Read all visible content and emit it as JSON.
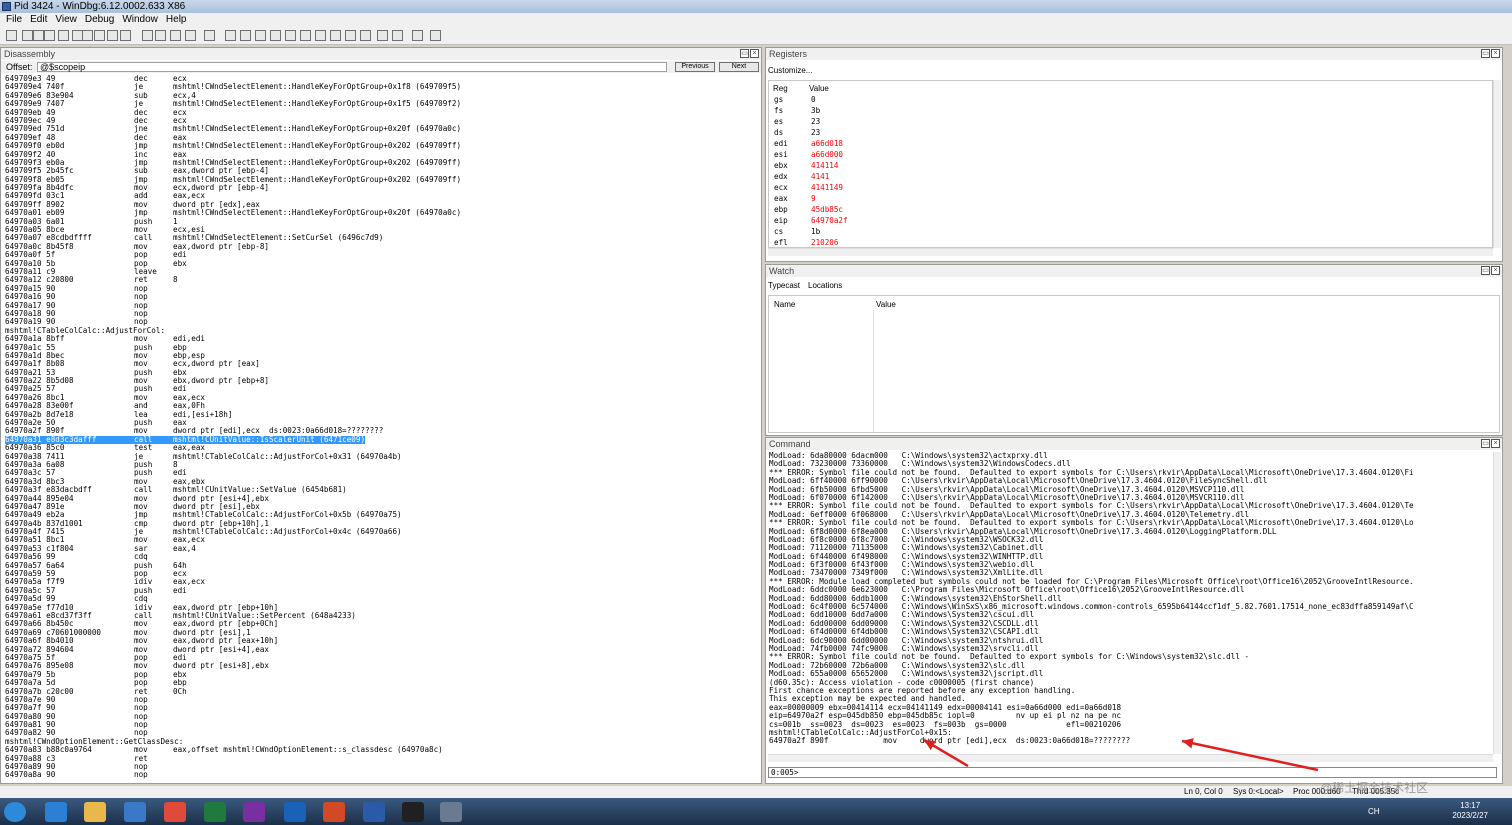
{
  "window": {
    "title": "Pid 3424 - WinDbg:6.12.0002.633 X86"
  },
  "menu": [
    "File",
    "Edit",
    "View",
    "Debug",
    "Window",
    "Help"
  ],
  "disassembly": {
    "title": "Disassembly",
    "offset_label": "Offset:",
    "offset_value": "@$scopeip",
    "prev_label": "Previous",
    "next_label": "Next",
    "highlight_index": 43,
    "lines": [
      [
        "649709e3 49",
        "dec",
        "ecx"
      ],
      [
        "649709e4 740f",
        "je",
        "mshtml!CWndSelectElement::HandleKeyForOptGroup+0x1f8 (649709f5)"
      ],
      [
        "649709e6 83e904",
        "sub",
        "ecx,4"
      ],
      [
        "649709e9 7407",
        "je",
        "mshtml!CWndSelectElement::HandleKeyForOptGroup+0x1f5 (649709f2)"
      ],
      [
        "649709eb 49",
        "dec",
        "ecx"
      ],
      [
        "649709ec 49",
        "dec",
        "ecx"
      ],
      [
        "649709ed 751d",
        "jne",
        "mshtml!CWndSelectElement::HandleKeyForOptGroup+0x20f (64970a0c)"
      ],
      [
        "649709ef 48",
        "dec",
        "eax"
      ],
      [
        "649709f0 eb0d",
        "jmp",
        "mshtml!CWndSelectElement::HandleKeyForOptGroup+0x202 (649709ff)"
      ],
      [
        "649709f2 40",
        "inc",
        "eax"
      ],
      [
        "649709f3 eb0a",
        "jmp",
        "mshtml!CWndSelectElement::HandleKeyForOptGroup+0x202 (649709ff)"
      ],
      [
        "649709f5 2b45fc",
        "sub",
        "eax,dword ptr [ebp-4]"
      ],
      [
        "649709f8 eb05",
        "jmp",
        "mshtml!CWndSelectElement::HandleKeyForOptGroup+0x202 (649709ff)"
      ],
      [
        "649709fa 8b4dfc",
        "mov",
        "ecx,dword ptr [ebp-4]"
      ],
      [
        "649709fd 03c1",
        "add",
        "eax,ecx"
      ],
      [
        "649709ff 8902",
        "mov",
        "dword ptr [edx],eax"
      ],
      [
        "64970a01 eb09",
        "jmp",
        "mshtml!CWndSelectElement::HandleKeyForOptGroup+0x20f (64970a0c)"
      ],
      [
        "64970a03 6a01",
        "push",
        "1"
      ],
      [
        "64970a05 8bce",
        "mov",
        "ecx,esi"
      ],
      [
        "64970a07 e8cdbdffff",
        "call",
        "mshtml!CWndSelectElement::SetCurSel (6496c7d9)"
      ],
      [
        "64970a0c 8b45f8",
        "mov",
        "eax,dword ptr [ebp-8]"
      ],
      [
        "64970a0f 5f",
        "pop",
        "edi"
      ],
      [
        "64970a10 5b",
        "pop",
        "ebx"
      ],
      [
        "64970a11 c9",
        "leave",
        ""
      ],
      [
        "64970a12 c20800",
        "ret",
        "8"
      ],
      [
        "64970a15 90",
        "nop",
        ""
      ],
      [
        "64970a16 90",
        "nop",
        ""
      ],
      [
        "64970a17 90",
        "nop",
        ""
      ],
      [
        "64970a18 90",
        "nop",
        ""
      ],
      [
        "64970a19 90",
        "nop",
        ""
      ],
      [
        "mshtml!CTableColCalc::AdjustForCol:",
        "",
        ""
      ],
      [
        "64970a1a 8bff",
        "mov",
        "edi,edi"
      ],
      [
        "64970a1c 55",
        "push",
        "ebp"
      ],
      [
        "64970a1d 8bec",
        "mov",
        "ebp,esp"
      ],
      [
        "64970a1f 8b08",
        "mov",
        "ecx,dword ptr [eax]"
      ],
      [
        "64970a21 53",
        "push",
        "ebx"
      ],
      [
        "64970a22 8b5d08",
        "mov",
        "ebx,dword ptr [ebp+8]"
      ],
      [
        "64970a25 57",
        "push",
        "edi"
      ],
      [
        "64970a26 8bc1",
        "mov",
        "eax,ecx"
      ],
      [
        "64970a28 83e00f",
        "and",
        "eax,0Fh"
      ],
      [
        "64970a2b 8d7e18",
        "lea",
        "edi,[esi+18h]"
      ],
      [
        "64970a2e 50",
        "push",
        "eax"
      ],
      [
        "64970a2f 890f",
        "mov",
        "dword ptr [edi],ecx  ds:0023:0a66d018=????????"
      ],
      [
        "64970a31 e8d3c3dafff",
        "call",
        "mshtml!CUnitValue::IsScalerUnit (6471ce09)"
      ],
      [
        "64970a36 85c0",
        "test",
        "eax,eax"
      ],
      [
        "64970a38 7411",
        "je",
        "mshtml!CTableColCalc::AdjustForCol+0x31 (64970a4b)"
      ],
      [
        "64970a3a 6a08",
        "push",
        "8"
      ],
      [
        "64970a3c 57",
        "push",
        "edi"
      ],
      [
        "64970a3d 8bc3",
        "mov",
        "eax,ebx"
      ],
      [
        "64970a3f e83dacbdff",
        "call",
        "mshtml!CUnitValue::SetValue (6454b681)"
      ],
      [
        "64970a44 895e04",
        "mov",
        "dword ptr [esi+4],ebx"
      ],
      [
        "64970a47 891e",
        "mov",
        "dword ptr [esi],ebx"
      ],
      [
        "64970a49 eb2a",
        "jmp",
        "mshtml!CTableColCalc::AdjustForCol+0x5b (64970a75)"
      ],
      [
        "64970a4b 837d1001",
        "cmp",
        "dword ptr [ebp+10h],1"
      ],
      [
        "64970a4f 7415",
        "je",
        "mshtml!CTableColCalc::AdjustForCol+0x4c (64970a66)"
      ],
      [
        "64970a51 8bc1",
        "mov",
        "eax,ecx"
      ],
      [
        "64970a53 c1f804",
        "sar",
        "eax,4"
      ],
      [
        "64970a56 99",
        "cdq",
        ""
      ],
      [
        "64970a57 6a64",
        "push",
        "64h"
      ],
      [
        "64970a59 59",
        "pop",
        "ecx"
      ],
      [
        "64970a5a f7f9",
        "idiv",
        "eax,ecx"
      ],
      [
        "64970a5c 57",
        "push",
        "edi"
      ],
      [
        "64970a5d 99",
        "cdq",
        ""
      ],
      [
        "64970a5e f77d10",
        "idiv",
        "eax,dword ptr [ebp+10h]"
      ],
      [
        "64970a61 e8cd37f3ff",
        "call",
        "mshtml!CUnitValue::SetPercent (648a4233)"
      ],
      [
        "64970a66 8b450c",
        "mov",
        "eax,dword ptr [ebp+0Ch]"
      ],
      [
        "64970a69 c70601000000",
        "mov",
        "dword ptr [esi],1"
      ],
      [
        "64970a6f 8b4010",
        "mov",
        "eax,dword ptr [eax+10h]"
      ],
      [
        "64970a72 894604",
        "mov",
        "dword ptr [esi+4],eax"
      ],
      [
        "64970a75 5f",
        "pop",
        "edi"
      ],
      [
        "64970a76 895e08",
        "mov",
        "dword ptr [esi+8],ebx"
      ],
      [
        "64970a79 5b",
        "pop",
        "ebx"
      ],
      [
        "64970a7a 5d",
        "pop",
        "ebp"
      ],
      [
        "64970a7b c20c00",
        "ret",
        "0Ch"
      ],
      [
        "64970a7e 90",
        "nop",
        ""
      ],
      [
        "64970a7f 90",
        "nop",
        ""
      ],
      [
        "64970a80 90",
        "nop",
        ""
      ],
      [
        "64970a81 90",
        "nop",
        ""
      ],
      [
        "64970a82 90",
        "nop",
        ""
      ],
      [
        "mshtml!CWndOptionElement::GetClassDesc:",
        "",
        ""
      ],
      [
        "64970a83 b88c0a9764",
        "mov",
        "eax,offset mshtml!CWndOptionElement::s_classdesc (64970a8c)"
      ],
      [
        "64970a88 c3",
        "ret",
        ""
      ],
      [
        "64970a89 90",
        "nop",
        ""
      ],
      [
        "64970a8a 90",
        "nop",
        ""
      ]
    ]
  },
  "registers": {
    "title": "Registers",
    "customize_label": "Customize...",
    "col_reg": "Reg",
    "col_value": "Value",
    "rows": [
      {
        "name": "gs",
        "value": "0",
        "changed": false
      },
      {
        "name": "fs",
        "value": "3b",
        "changed": false
      },
      {
        "name": "es",
        "value": "23",
        "changed": false
      },
      {
        "name": "ds",
        "value": "23",
        "changed": false
      },
      {
        "name": "edi",
        "value": "a66d018",
        "changed": true
      },
      {
        "name": "esi",
        "value": "a66d000",
        "changed": true
      },
      {
        "name": "ebx",
        "value": "414114",
        "changed": true
      },
      {
        "name": "edx",
        "value": "4141",
        "changed": true
      },
      {
        "name": "ecx",
        "value": "4141149",
        "changed": true
      },
      {
        "name": "eax",
        "value": "9",
        "changed": true
      },
      {
        "name": "ebp",
        "value": "45db85c",
        "changed": true
      },
      {
        "name": "eip",
        "value": "64970a2f",
        "changed": true
      },
      {
        "name": "cs",
        "value": "1b",
        "changed": false
      },
      {
        "name": "efl",
        "value": "210206",
        "changed": true
      }
    ],
    "changed_color": "#ff0000"
  },
  "watch": {
    "title": "Watch",
    "typecast_label": "Typecast",
    "locations_label": "Locations",
    "col_name": "Name",
    "col_value": "Value"
  },
  "command": {
    "title": "Command",
    "prompt": "0:005>",
    "lines": [
      "ModLoad: 6da80000 6dacm000   C:\\Windows\\system32\\actxprxy.dll",
      "ModLoad: 73230000 73360000   C:\\Windows\\system32\\WindowsCodecs.dll",
      "*** ERROR: Symbol file could not be found.  Defaulted to export symbols for C:\\Users\\rkvir\\AppData\\Local\\Microsoft\\OneDrive\\17.3.4604.0120\\Fi",
      "ModLoad: 6ff40000 6ff90000   C:\\Users\\rkvir\\AppData\\Local\\Microsoft\\OneDrive\\17.3.4604.0120\\FileSyncShell.dll",
      "ModLoad: 6fb50000 6fbd5000   C:\\Users\\rkvir\\AppData\\Local\\Microsoft\\OneDrive\\17.3.4604.0120\\MSVCP110.dll",
      "ModLoad: 6f070000 6f142000   C:\\Users\\rkvir\\AppData\\Local\\Microsoft\\OneDrive\\17.3.4604.0120\\MSVCR110.dll",
      "*** ERROR: Symbol file could not be found.  Defaulted to export symbols for C:\\Users\\rkvir\\AppData\\Local\\Microsoft\\OneDrive\\17.3.4604.0120\\Te",
      "ModLoad: 6eff0000 6f068000   C:\\Users\\rkvir\\AppData\\Local\\Microsoft\\OneDrive\\17.3.4604.0120\\Telemetry.dll",
      "*** ERROR: Symbol file could not be found.  Defaulted to export symbols for C:\\Users\\rkvir\\AppData\\Local\\Microsoft\\OneDrive\\17.3.4604.0120\\Lo",
      "ModLoad: 6f8d0000 6f8ea000   C:\\Users\\rkvir\\AppData\\Local\\Microsoft\\OneDrive\\17.3.4604.0120\\LoggingPlatform.DLL",
      "ModLoad: 6f8c0000 6f8c7000   C:\\Windows\\system32\\WSOCK32.dll",
      "ModLoad: 71120000 71135000   C:\\Windows\\system32\\Cabinet.dll",
      "ModLoad: 6f440000 6f498000   C:\\Windows\\system32\\WINHTTP.dll",
      "ModLoad: 6f3f0000 6f43f000   C:\\Windows\\system32\\webio.dll",
      "ModLoad: 73470000 7349f000   C:\\Windows\\system32\\XmlLite.dll",
      "*** ERROR: Module load completed but symbols could not be loaded for C:\\Program Files\\Microsoft Office\\root\\Office16\\2052\\GrooveIntlResource.",
      "ModLoad: 6ddc0000 6e623000   C:\\Program Files\\Microsoft Office\\root\\Office16\\2052\\GrooveIntlResource.dll",
      "ModLoad: 6dd80000 6ddb1000   C:\\Windows\\system32\\EhStorShell.dll",
      "ModLoad: 6c4f0000 6c574000   C:\\Windows\\WinSxS\\x86_microsoft.windows.common-controls_6595b64144ccf1df_5.82.7601.17514_none_ec83dffa859149af\\C",
      "ModLoad: 6dd10000 6dd7a000   C:\\Windows\\System32\\cscui.dll",
      "ModLoad: 6dd00000 6dd09000   C:\\Windows\\System32\\CSCDLL.dll",
      "ModLoad: 6f4d0000 6f4db000   C:\\Windows\\System32\\CSCAPI.dll",
      "ModLoad: 6dc90000 6dd00000   C:\\Windows\\system32\\ntshrui.dll",
      "ModLoad: 74fb0000 74fc9000   C:\\Windows\\system32\\srvcli.dll",
      "*** ERROR: Symbol file could not be found.  Defaulted to export symbols for C:\\Windows\\system32\\slc.dll -",
      "ModLoad: 72b60000 72b6a000   C:\\Windows\\system32\\slc.dll",
      "ModLoad: 655a0000 65652000   C:\\Windows\\system32\\jscript.dll",
      "(d60.35c): Access violation - code c0000005 (first chance)",
      "First chance exceptions are reported before any exception handling.",
      "This exception may be expected and handled.",
      "eax=00000009 ebx=00414114 ecx=04141149 edx=00004141 esi=0a66d000 edi=0a66d018",
      "eip=64970a2f esp=045db850 ebp=045db85c iopl=0         nv up ei pl nz na pe nc",
      "cs=001b  ss=0023  ds=0023  es=0023  fs=003b  gs=0000             efl=00210206",
      "mshtml!CTableColCalc::AdjustForCol+0x15:",
      "64970a2f 890f            mov     dword ptr [edi],ecx  ds:0023:0a66d018=????????"
    ]
  },
  "statusbar": {
    "ln_col": "Ln 0, Col 0",
    "sys": "Sys 0:<Local>",
    "proc": "Proc 000:d60",
    "thrd": "Thrd 005:35c"
  },
  "taskbar": {
    "time": "13:17",
    "date": "2023/2/27",
    "lang": "CH",
    "icons": [
      {
        "name": "start-orb-icon",
        "color": "#2d8ad8"
      },
      {
        "name": "ie-icon",
        "color": "#2b7fd4"
      },
      {
        "name": "explorer-icon",
        "color": "#e8b84a"
      },
      {
        "name": "media-player-icon",
        "color": "#3a78c8"
      },
      {
        "name": "chrome-icon",
        "color": "#e04a3a"
      },
      {
        "name": "excel-icon",
        "color": "#1f7a3f"
      },
      {
        "name": "onenote-icon",
        "color": "#7a2fa0"
      },
      {
        "name": "outlook-icon",
        "color": "#1a62b8"
      },
      {
        "name": "powerpoint-icon",
        "color": "#d24a25"
      },
      {
        "name": "word-icon",
        "color": "#2a5aa8"
      },
      {
        "name": "cmd-icon",
        "color": "#202020"
      },
      {
        "name": "windbg-icon",
        "color": "#6a7a90"
      }
    ]
  },
  "watermark": "@稀土掘金技术社区",
  "annotation_color": "#e02020"
}
